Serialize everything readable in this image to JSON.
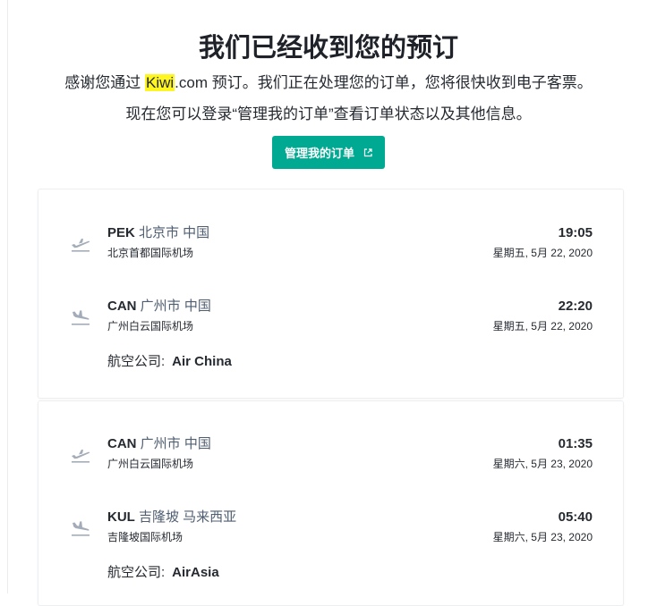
{
  "header": {
    "title": "我们已经收到您的预订",
    "thanks_prefix": "感谢您通过 ",
    "brand_highlight": "Kiwi",
    "thanks_suffix": ".com 预订。我们正在处理您的订单，您将很快收到电子客票。",
    "manage_hint": "现在您可以登录“管理我的订单”查看订单状态以及其他信息。",
    "manage_button": "管理我的订单"
  },
  "colors": {
    "accent": "#00a991",
    "highlight": "#fff51f"
  },
  "trips": [
    {
      "segments": [
        {
          "code": "PEK",
          "city": "北京市 中国",
          "airport": "北京首都国际机场",
          "time": "19:05",
          "date": "星期五, 5月 22, 2020",
          "icon": "takeoff-icon"
        },
        {
          "code": "CAN",
          "city": "广州市 中国",
          "airport": "广州白云国际机场",
          "time": "22:20",
          "date": "星期五, 5月 22, 2020",
          "icon": "landing-icon"
        }
      ],
      "airline_label": "航空公司:",
      "airline": "Air China"
    },
    {
      "segments": [
        {
          "code": "CAN",
          "city": "广州市 中国",
          "airport": "广州白云国际机场",
          "time": "01:35",
          "date": "星期六, 5月 23, 2020",
          "icon": "takeoff-icon"
        },
        {
          "code": "KUL",
          "city": "吉隆坡 马来西亚",
          "airport": "吉隆坡国际机场",
          "time": "05:40",
          "date": "星期六, 5月 23, 2020",
          "icon": "landing-icon"
        }
      ],
      "airline_label": "航空公司:",
      "airline": "AirAsia"
    }
  ]
}
